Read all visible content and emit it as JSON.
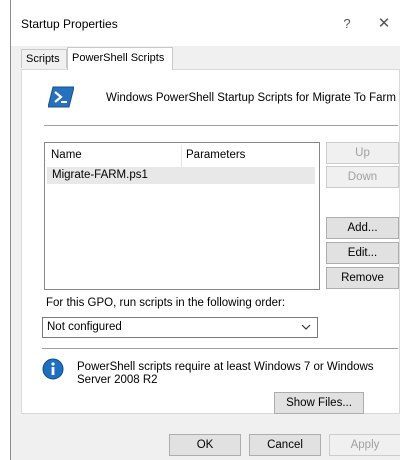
{
  "window": {
    "title": "Startup Properties",
    "help_label": "?",
    "close_label": "✕"
  },
  "tabs": [
    {
      "label": "Scripts",
      "active": false
    },
    {
      "label": "PowerShell Scripts",
      "active": true
    }
  ],
  "header": {
    "text": "Windows PowerShell Startup Scripts for Migrate To Farm",
    "icon": "powershell-icon"
  },
  "list": {
    "columns": [
      "Name",
      "Parameters"
    ],
    "rows": [
      {
        "name": "Migrate-FARM.ps1",
        "parameters": "",
        "selected": true
      }
    ]
  },
  "side_buttons": {
    "up": "Up",
    "down": "Down",
    "add": "Add...",
    "edit": "Edit...",
    "remove": "Remove"
  },
  "order": {
    "label": "For this GPO, run scripts in the following order:",
    "selected": "Not configured"
  },
  "info": {
    "icon": "info-icon",
    "text": "PowerShell scripts require at least Windows 7 or Windows Server 2008 R2",
    "show_files": "Show Files..."
  },
  "footer": {
    "ok": "OK",
    "cancel": "Cancel",
    "apply": "Apply"
  },
  "colors": {
    "window_bg": "#f0f0f0",
    "panel_bg": "#ffffff",
    "selection": "#e8e8e8",
    "powershell_blue": "#2671be",
    "info_blue": "#1e6fbf"
  }
}
